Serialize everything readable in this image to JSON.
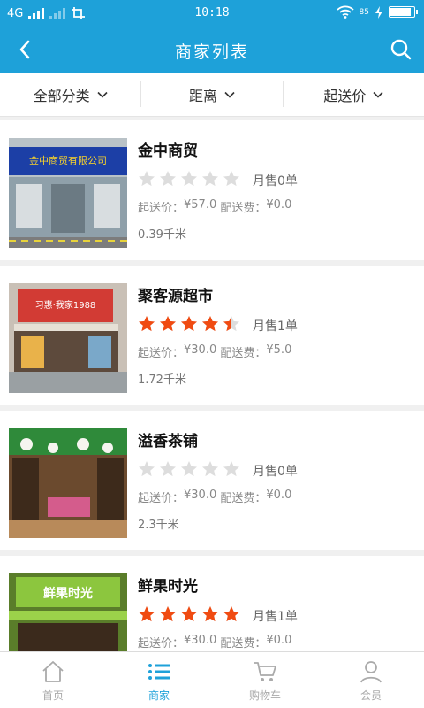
{
  "status_bar": {
    "network": "4G",
    "time": "10:18",
    "battery": "85"
  },
  "nav": {
    "title": "商家列表"
  },
  "filters": [
    {
      "label": "全部分类"
    },
    {
      "label": "距离"
    },
    {
      "label": "起送价"
    }
  ],
  "stores": [
    {
      "name": "金中商贸",
      "rating": 0,
      "sales": "月售0单",
      "min_label": "起送价：",
      "min_value": "¥57.0",
      "fee_label": "配送费：",
      "fee_value": "¥0.0",
      "distance": "0.39千米",
      "sign_text": "金中商贸有限公司"
    },
    {
      "name": "聚客源超市",
      "rating": 4.5,
      "sales": "月售1单",
      "min_label": "起送价：",
      "min_value": "¥30.0",
      "fee_label": "配送费：",
      "fee_value": "¥5.0",
      "distance": "1.72千米",
      "sign_text": "习惠·我家1988"
    },
    {
      "name": "溢香茶铺",
      "rating": 0,
      "sales": "月售0单",
      "min_label": "起送价：",
      "min_value": "¥30.0",
      "fee_label": "配送费：",
      "fee_value": "¥0.0",
      "distance": "2.3千米",
      "sign_text": ""
    },
    {
      "name": "鲜果时光",
      "rating": 5,
      "sales": "月售1单",
      "min_label": "起送价：",
      "min_value": "¥30.0",
      "fee_label": "配送费：",
      "fee_value": "¥0.0",
      "distance": "",
      "sign_text": "鲜果时光"
    }
  ],
  "tabs": [
    {
      "label": "首页",
      "icon": "home-icon",
      "active": false
    },
    {
      "label": "商家",
      "icon": "list-icon",
      "active": true
    },
    {
      "label": "购物车",
      "icon": "cart-icon",
      "active": false
    },
    {
      "label": "会员",
      "icon": "user-icon",
      "active": false
    }
  ],
  "colors": {
    "accent": "#1ea1d9",
    "star_on": "#f04b12",
    "star_off": "#dddddd"
  }
}
